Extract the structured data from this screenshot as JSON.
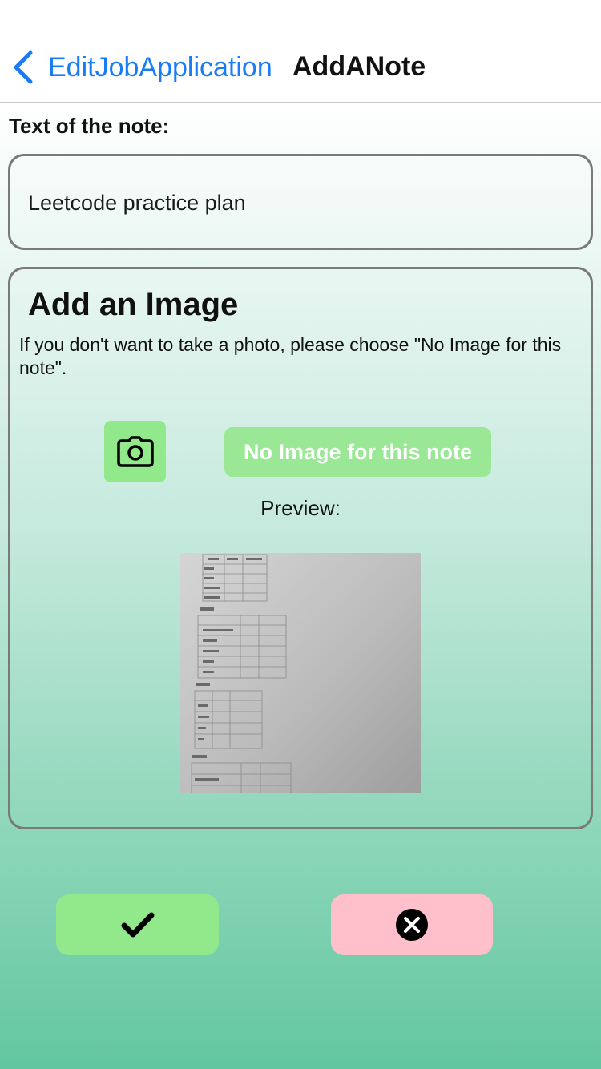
{
  "nav": {
    "back_label": "EditJobApplication",
    "title": "AddANote"
  },
  "note": {
    "label": "Text of the note:",
    "value": "Leetcode practice plan"
  },
  "image_section": {
    "title": "Add an Image",
    "description": "If you don't want to take a photo, please choose \"No Image for this note\".",
    "camera_icon": "camera-icon",
    "no_image_label": "No Image for this note",
    "preview_label": "Preview:"
  },
  "actions": {
    "confirm_icon": "checkmark-icon",
    "cancel_icon": "close-circle-icon"
  },
  "colors": {
    "accent_blue": "#1a7cf5",
    "confirm_green": "#92e98c",
    "cancel_pink": "#ffc0cb",
    "gradient_bottom": "#62c79f"
  }
}
